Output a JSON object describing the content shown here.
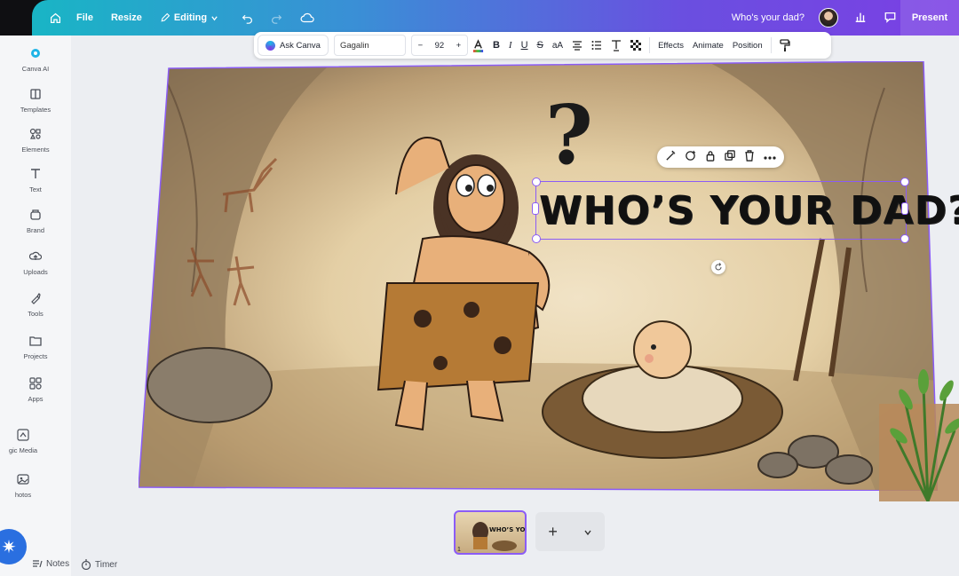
{
  "topbar": {
    "file": "File",
    "resize": "Resize",
    "mode": "Editing",
    "design_title": "Who's your dad?",
    "present": "Present"
  },
  "sidebar": {
    "items": [
      {
        "label": "Canva AI",
        "icon": "canva-ai-icon"
      },
      {
        "label": "Templates",
        "icon": "templates-icon"
      },
      {
        "label": "Elements",
        "icon": "elements-icon"
      },
      {
        "label": "Text",
        "icon": "text-icon"
      },
      {
        "label": "Brand",
        "icon": "brand-icon"
      },
      {
        "label": "Uploads",
        "icon": "uploads-icon"
      },
      {
        "label": "Tools",
        "icon": "tools-icon"
      },
      {
        "label": "Projects",
        "icon": "projects-icon"
      },
      {
        "label": "Apps",
        "icon": "apps-icon"
      },
      {
        "label": "gic Media",
        "icon": "magic-media-icon"
      },
      {
        "label": "hotos",
        "icon": "photos-icon"
      }
    ]
  },
  "toolbar": {
    "ask": "Ask Canva",
    "font": "Gagalin",
    "minus": "−",
    "font_size": "92",
    "plus": "+",
    "bold": "B",
    "italic": "I",
    "underline": "U",
    "strike": "S",
    "case": "aA",
    "effects": "Effects",
    "animate": "Animate",
    "position": "Position"
  },
  "canvas": {
    "headline": "WHO’S YOUR DAD?",
    "question_mark": "?"
  },
  "bottom": {
    "notes": "Notes",
    "timer": "Timer",
    "page_number": "1",
    "add": "+"
  },
  "colors": {
    "accent": "#8b5cf6",
    "topbar_start": "#19b5c5",
    "topbar_end": "#7b3fe4"
  }
}
